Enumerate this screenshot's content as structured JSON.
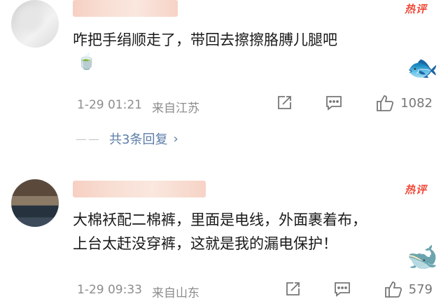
{
  "comments": [
    {
      "hot_badge": "热评",
      "text": "咋把手绢顺走了，带回去擦擦胳膊儿腿吧",
      "time": "1-29 01:21",
      "location": "来自江苏",
      "likes": "1082",
      "replies": {
        "dash": "——",
        "label": "共3条回复",
        "chevron": "›"
      }
    },
    {
      "hot_badge": "热评",
      "text_lines": [
        "大棉袄配二棉裤，里面是电线，外面裹着布，",
        "上台太赶没穿裤，这就是我的漏电保护！"
      ],
      "time": "1-29 09:33",
      "location": "来自山东",
      "likes": "579"
    }
  ]
}
